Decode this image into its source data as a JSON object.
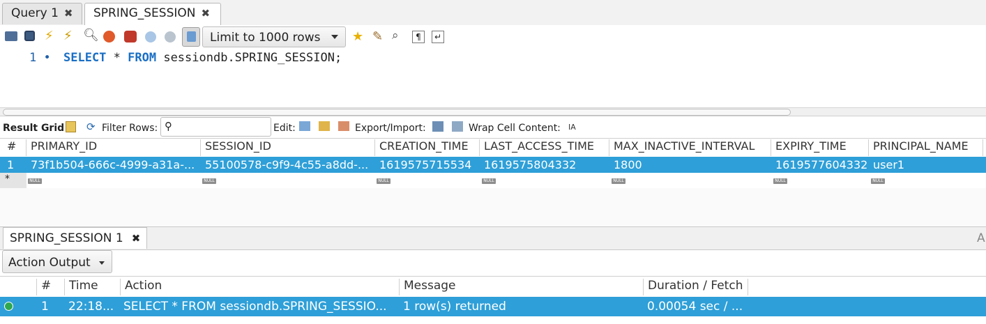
{
  "tabs": [
    {
      "label": "Query 1",
      "close": "✖"
    },
    {
      "label": "SPRING_SESSION",
      "close": "✖"
    }
  ],
  "toolbar": {
    "limit_select": "Limit to 1000 rows",
    "icons": [
      "open-folder-icon",
      "save-icon",
      "execute-icon",
      "execute-current-icon",
      "explain-icon",
      "stop-icon",
      "toggle-error-icon",
      "commit-icon",
      "rollback-icon",
      "autocommit-icon",
      "bookmark-icon",
      "beautify-icon",
      "find-icon",
      "invisible-chars-icon",
      "wrap-icon"
    ]
  },
  "editor": {
    "line_number": "1",
    "line_marker": "•",
    "tokens": {
      "select": "SELECT",
      "star": " * ",
      "from": "FROM",
      "rest": " sessiondb.SPRING_SESSION;"
    }
  },
  "result_toolbar": {
    "result_grid": "Result Grid",
    "filter_rows": "Filter Rows:",
    "edit": "Edit:",
    "export_import": "Export/Import:",
    "wrap_cell": "Wrap Cell Content:"
  },
  "grid": {
    "columns": [
      "#",
      "PRIMARY_ID",
      "SESSION_ID",
      "CREATION_TIME",
      "LAST_ACCESS_TIME",
      "MAX_INACTIVE_INTERVAL",
      "EXPIRY_TIME",
      "PRINCIPAL_NAME"
    ],
    "row": [
      "1",
      "73f1b504-666c-4999-a31a-...",
      "55100578-c9f9-4c55-a8dd-...",
      "1619575715534",
      "1619575804332",
      "1800",
      "1619577604332",
      "user1"
    ],
    "new_row_marker": "*",
    "null_label": "NULL"
  },
  "bottom": {
    "tab_label": "SPRING_SESSION 1",
    "tab_close": "✖",
    "right_edge": "A",
    "output_select": "Action Output",
    "columns": [
      "#",
      "Time",
      "Action",
      "Message",
      "Duration / Fetch"
    ],
    "row": {
      "num": "1",
      "time": "22:18...",
      "action": "SELECT * FROM sessiondb.SPRING_SESSIO...",
      "message": "1 row(s) returned",
      "duration": "0.00054 sec / ..."
    }
  },
  "colors": {
    "selection": "#2e9fd8",
    "keyword": "#1a6fc4",
    "success": "#2fa84f"
  }
}
